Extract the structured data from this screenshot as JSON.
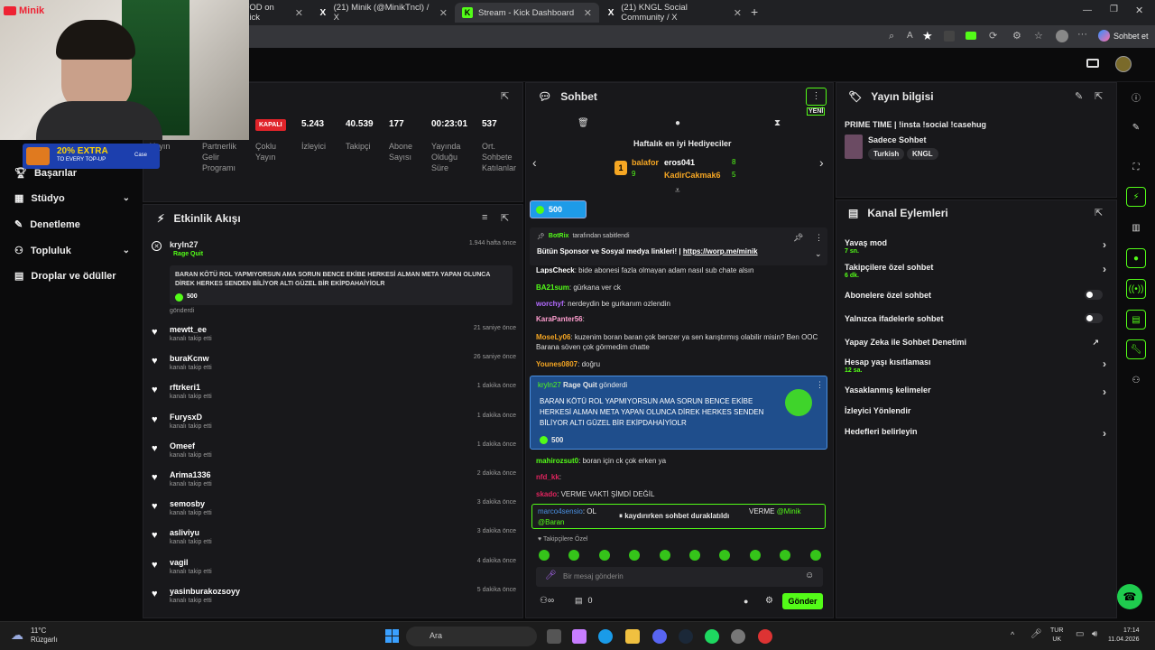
{
  "browser": {
    "tabs": [
      {
        "label": "VOD on Kick"
      },
      {
        "label": "(21) Minik (@MinikTncl) / X"
      },
      {
        "label": "Stream - Kick Dashboard"
      },
      {
        "label": "(21) KNGL Social Community / X"
      }
    ],
    "sohbet_et": "Sohbet et"
  },
  "overlay": {
    "brand": "Minik",
    "promo_big": "20% EXTRA",
    "promo_small": "TO EVERY TOP-UP",
    "promo_sub": "Case"
  },
  "sidebar": {
    "items": [
      {
        "label": "Başarılar"
      },
      {
        "label": "Stüdyo"
      },
      {
        "label": "Denetleme"
      },
      {
        "label": "Topluluk"
      },
      {
        "label": "Droplar ve ödüller"
      }
    ]
  },
  "stats_panel": {
    "title": "eri",
    "status": "KAPALI",
    "labels": [
      "Yayın",
      "Partnerlik Gelir Programı",
      "Çoklu Yayın"
    ],
    "stats": [
      {
        "value": "5.243",
        "label": "İzleyici"
      },
      {
        "value": "40.539",
        "label": "Takipçi"
      },
      {
        "value": "177",
        "label": "Abone Sayısı"
      },
      {
        "value": "00:23:01",
        "label": "Yayında Olduğu Süre"
      },
      {
        "value": "537",
        "label": "Ort. Sohbete Katılanlar"
      }
    ]
  },
  "activity": {
    "title": "Etkinlik Akışı",
    "gift": {
      "user": "kryln27",
      "item": "Rage Quit",
      "time": "1.944 hafta önce",
      "msg": "BARAN KÖTÜ ROL YAPMIYORSUN AMA SORUN BENCE EKİBE HERKESİ ALMAN META YAPAN OLUNCA DİREK HERKES SENDEN BİLİYOR ALTI GÜZEL BİR EKİPDAHAİYİOLR",
      "amount": "500",
      "sent": "gönderdi"
    },
    "follows": [
      {
        "user": "mewtt_ee",
        "time": "21 saniye önce"
      },
      {
        "user": "buraKcnw",
        "time": "26 saniye önce"
      },
      {
        "user": "rftrkeri1",
        "time": "1 dakika önce"
      },
      {
        "user": "FurysxD",
        "time": "1 dakika önce"
      },
      {
        "user": "Omeef",
        "time": "1 dakika önce"
      },
      {
        "user": "Arima1336",
        "time": "2 dakika önce"
      },
      {
        "user": "semosby",
        "time": "3 dakika önce"
      },
      {
        "user": "asliviyu",
        "time": "3 dakika önce"
      },
      {
        "user": "vagil",
        "time": "4 dakika önce"
      },
      {
        "user": "yasinburakozsoyy",
        "time": "5 dakika önce"
      }
    ],
    "follow_text": "kanalı takip etti"
  },
  "chat": {
    "title": "Sohbet",
    "badge": "YENİ",
    "gifters_title": "Haftalık en iyi Hediyeciler",
    "gifters": [
      {
        "rank": "1",
        "name": "balafor",
        "count": "9",
        "color": "#f5a623"
      },
      {
        "name": "eros041",
        "count": "8",
        "color": "#ffffff"
      },
      {
        "name": "KadirCakmak6",
        "count": "5",
        "color": "#f5a623"
      }
    ],
    "kicks": "500",
    "pinned": {
      "by": "BotRix",
      "by_suffix": "tarafından sabitlendi",
      "text": "Bütün Sponsor ve Sosyal medya linkleri! |",
      "link": "https://worp.me/minik"
    },
    "messages": [
      {
        "user": "LapsCheck",
        "color": "#ffffff",
        "text": "bide abonesi fazla olmayan adam nasıl sub chate alsın"
      },
      {
        "user": "BA21sum",
        "color": "#53fc18",
        "text": "gürkana ver ck"
      },
      {
        "user": "worchyf",
        "color": "#b36bff",
        "text": "nerdeydin be gurkanım ozlendin"
      },
      {
        "user": "KaraPanter56",
        "color": "#ff9ecf",
        "text": ""
      },
      {
        "user": "MoseLy06",
        "color": "#f5a623",
        "text": "kuzenim boran baran çok benzer ya sen karıştırmış olabilir misin? Ben OOC Barana söven çok görmedim chatte"
      },
      {
        "user": "Younes0807",
        "color": "#f5a623",
        "text": "doğru"
      }
    ],
    "highlight": {
      "user": "kryln27",
      "item": "Rage Quit",
      "suffix": "gönderdi",
      "text": "BARAN KÖTÜ ROL YAPMIYORSUN AMA SORUN BENCE EKİBE HERKESİ ALMAN META YAPAN OLUNCA DİREK HERKES SENDEN BİLİYOR ALTI GÜZEL BİR EKİPDAHAİYİOLR",
      "amount": "500"
    },
    "messages2": [
      {
        "user": "mahirozsut0",
        "color": "#53fc18",
        "text": "boran için ck çok erken ya"
      },
      {
        "user": "nfd_kk",
        "color": "#e0245e",
        "text": ""
      },
      {
        "user": "skado",
        "color": "#e0245e",
        "text": "VERME VAKTİ ŞİMDİ DEĞİL"
      }
    ],
    "reply": {
      "user": "marco4sensio",
      "text": "OL",
      "mention_pre": "VERME",
      "mention": "@Minik",
      "mention2": "@Baran"
    },
    "paused": "kaydırırken sohbet duraklatıldı",
    "followers_only": "Takipçilere Özel",
    "placeholder": "Bir mesaj gönderin",
    "points": "0",
    "send": "Gönder"
  },
  "stream_info": {
    "title": "Yayın bilgisi",
    "stream_title": "PRIME TIME | !insta !social !casehug",
    "category": "Sadece Sohbet",
    "tags": [
      "Turkish",
      "KNGL"
    ]
  },
  "channel_actions": {
    "title": "Kanal Eylemleri",
    "items": [
      {
        "label": "Yavaş mod",
        "sub": "7 sn."
      },
      {
        "label": "Takipçilere özel sohbet",
        "sub": "6 dk."
      },
      {
        "label": "Abonelere özel sohbet",
        "sub": ""
      },
      {
        "label": "Yalnızca ifadelerle sohbet",
        "sub": ""
      },
      {
        "label": "Yapay Zeka ile Sohbet Denetimi",
        "sub": ""
      },
      {
        "label": "Hesap yaşı kısıtlaması",
        "sub": "12 sa."
      },
      {
        "label": "Yasaklanmış kelimeler",
        "sub": ""
      },
      {
        "label": "İzleyici Yönlendir",
        "sub": ""
      },
      {
        "label": "Hedefleri belirleyin",
        "sub": ""
      }
    ]
  },
  "taskbar": {
    "weather_temp": "11°C",
    "weather_desc": "Rüzgarlı",
    "search": "Ara",
    "lang1": "TUR",
    "lang2": "UK",
    "time": "17:14",
    "date": "11.04.2026"
  },
  "colors": {
    "accent": "#53fc18",
    "panel": "#18181b",
    "bg": "#0b0b0c",
    "live_red": "#e0242a"
  }
}
